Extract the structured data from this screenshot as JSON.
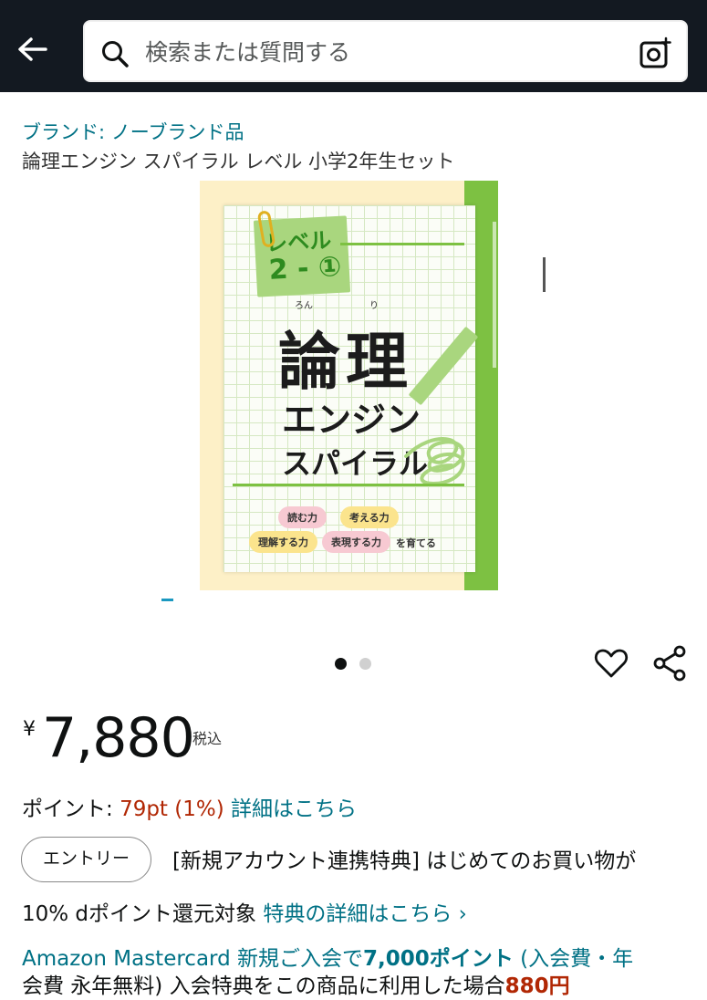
{
  "search": {
    "placeholder": "検索または質問する"
  },
  "product": {
    "brand": "ブランド: ノーブランド品",
    "title": "論理エンジン スパイラル レベル 小学2年生セット",
    "cover": {
      "level_label": "レベル",
      "level_num": "2 - ①",
      "ruby_ron": "ろん",
      "ruby_ri": "り",
      "title_kanji": "論理",
      "title_engine": "エンジン",
      "title_spiral": "スパイラル",
      "pill_read": "読む力",
      "pill_think": "考える力",
      "pill_understand": "理解する力",
      "pill_express": "表現する力",
      "tail": "を育てる"
    },
    "image_count": 2,
    "image_index": 1
  },
  "price": {
    "currency": "¥",
    "amount": "7,880",
    "tax": "税込"
  },
  "points": {
    "label": "ポイント: ",
    "value": "79pt",
    "percent": "(1%)",
    "details_link": "詳細はこちら"
  },
  "promo": {
    "entry_button": "エントリー",
    "line1": "[新規アカウント連携特典] はじめてのお買い物が",
    "line2": "10% dポイント還元対象",
    "details_link": "特典の詳細はこちら ›"
  },
  "mastercard": {
    "text1": "Amazon Mastercard 新規ご入会で",
    "bold": "7,000ポイント",
    "text2": " (入会費・年",
    "line2": "会費 永年無料) 入会特典をこの商品に利用した場合",
    "line2_red": "880円"
  },
  "colors": {
    "topbar": "#131921",
    "link": "#007185",
    "price_red": "#b12704",
    "spine_green": "#7dc142"
  }
}
